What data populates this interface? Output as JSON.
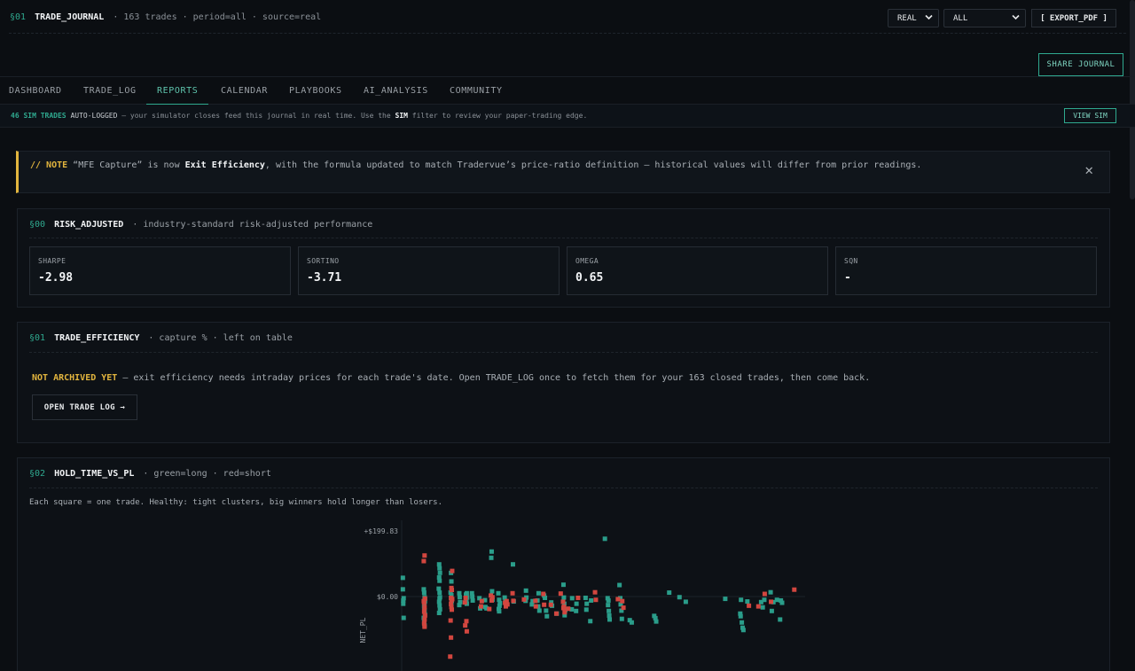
{
  "header": {
    "section": "§01",
    "title": "TRADE_JOURNAL",
    "meta": "· 163 trades · period=all · source=real",
    "source_select": "REAL",
    "period_select": "ALL",
    "export_label": "[ EXPORT_PDF ]",
    "share_label": "SHARE JOURNAL"
  },
  "tabs": [
    {
      "label": "DASHBOARD",
      "active": false
    },
    {
      "label": "TRADE_LOG",
      "active": false
    },
    {
      "label": "REPORTS",
      "active": true
    },
    {
      "label": "CALENDAR",
      "active": false
    },
    {
      "label": "PLAYBOOKS",
      "active": false
    },
    {
      "label": "AI_ANALYSIS",
      "active": false
    },
    {
      "label": "COMMUNITY",
      "active": false
    }
  ],
  "sim_banner": {
    "count": "46 SIM TRADES",
    "autolog": "AUTO-LOGGED",
    "text1": " — your simulator closes feed this journal in real time. Use the ",
    "filter": "SIM",
    "text2": " filter to review your paper-trading edge.",
    "button": "VIEW SIM"
  },
  "note": {
    "prefix": "// NOTE",
    "text1": " “MFE Capture” is now ",
    "bold": "Exit Efficiency",
    "text2": ", with the formula updated to match Tradervue’s price-ratio definition — historical values will differ from prior readings.",
    "close": "✕"
  },
  "risk": {
    "section": "§00",
    "title": "RISK_ADJUSTED",
    "subtitle": "· industry-standard risk-adjusted performance",
    "metrics": [
      {
        "label": "SHARPE",
        "value": "-2.98"
      },
      {
        "label": "SORTINO",
        "value": "-3.71"
      },
      {
        "label": "OMEGA",
        "value": "0.65"
      },
      {
        "label": "SQN",
        "value": "-"
      }
    ]
  },
  "efficiency": {
    "section": "§01",
    "title": "TRADE_EFFICIENCY",
    "subtitle": "· capture % · left on table",
    "warn": "NOT ARCHIVED YET",
    "text": " — exit efficiency needs intraday prices for each trade's date. Open TRADE_LOG once to fetch them for your 163 closed trades, then come back.",
    "button": "OPEN TRADE LOG →"
  },
  "hold": {
    "section": "§02",
    "title": "HOLD_TIME_VS_PL",
    "subtitle": "· green=long · red=short",
    "desc": "Each square = one trade. Healthy: tight clusters, big winners hold longer than losers."
  },
  "chart_data": {
    "type": "scatter",
    "ylabel": "NET_PL",
    "y_ticks": [
      "+$199.83",
      "$0.00"
    ],
    "y_max": 199.83,
    "series": [
      {
        "name": "long",
        "color": "#2a9d8a",
        "points": [
          [
            0.3,
            57
          ],
          [
            0.3,
            22
          ],
          [
            0.5,
            -5
          ],
          [
            0.4,
            -12
          ],
          [
            0.4,
            -22
          ],
          [
            0.5,
            -65
          ],
          [
            5.6,
            22
          ],
          [
            5.7,
            12
          ],
          [
            5.8,
            -2
          ],
          [
            5.9,
            -14
          ],
          [
            5.7,
            -28
          ],
          [
            5.8,
            -42
          ],
          [
            5.9,
            -55
          ],
          [
            5.6,
            -65
          ],
          [
            5.7,
            -78
          ],
          [
            5.8,
            -88
          ],
          [
            5.9,
            -7
          ],
          [
            5.8,
            -19
          ],
          [
            5.7,
            -33
          ],
          [
            9.5,
            98
          ],
          [
            9.6,
            86
          ],
          [
            9.7,
            72
          ],
          [
            9.5,
            58
          ],
          [
            9.6,
            48
          ],
          [
            9.4,
            24
          ],
          [
            9.6,
            12
          ],
          [
            9.7,
            -2
          ],
          [
            9.5,
            -16
          ],
          [
            9.6,
            -27
          ],
          [
            9.7,
            -39
          ],
          [
            9.5,
            -50
          ],
          [
            9.6,
            -6
          ],
          [
            12.5,
            72
          ],
          [
            12.6,
            46
          ],
          [
            12.4,
            12
          ],
          [
            12.6,
            4
          ],
          [
            12.5,
            -4
          ],
          [
            12.7,
            -13
          ],
          [
            12.6,
            -19
          ],
          [
            14.6,
            10
          ],
          [
            14.7,
            -2
          ],
          [
            14.8,
            -17
          ],
          [
            14.6,
            -26
          ],
          [
            16.3,
            6
          ],
          [
            16.5,
            10
          ],
          [
            16.6,
            -3
          ],
          [
            16.4,
            -14
          ],
          [
            16.5,
            -22
          ],
          [
            17.8,
            10
          ],
          [
            17.9,
            0
          ],
          [
            18.0,
            -12
          ],
          [
            19.7,
            -5
          ],
          [
            19.9,
            -36
          ],
          [
            21.1,
            -11
          ],
          [
            21.2,
            -32
          ],
          [
            21.5,
            -36
          ],
          [
            22.8,
            137
          ],
          [
            22.7,
            118
          ],
          [
            22.9,
            16
          ],
          [
            23.0,
            -10
          ],
          [
            24.5,
            10
          ],
          [
            24.7,
            -10
          ],
          [
            24.9,
            -20
          ],
          [
            24.8,
            -28
          ],
          [
            24.6,
            -38
          ],
          [
            24.7,
            -45
          ],
          [
            26.1,
            -3
          ],
          [
            26.3,
            -14
          ],
          [
            28.2,
            98
          ],
          [
            28.4,
            -15
          ],
          [
            31.5,
            18
          ],
          [
            31.6,
            -3
          ],
          [
            31.4,
            -13
          ],
          [
            33.0,
            -24
          ],
          [
            33.2,
            -14
          ],
          [
            34.4,
            -12
          ],
          [
            34.7,
            10
          ],
          [
            34.6,
            -30
          ],
          [
            34.9,
            -43
          ],
          [
            36.1,
            3
          ],
          [
            36.3,
            -4
          ],
          [
            36.6,
            -43
          ],
          [
            36.8,
            -60
          ],
          [
            37.9,
            -18
          ],
          [
            38.1,
            -28
          ],
          [
            39.3,
            -52
          ],
          [
            41.0,
            36
          ],
          [
            41.1,
            -3
          ],
          [
            41.2,
            -22
          ],
          [
            41.3,
            -57
          ],
          [
            41.4,
            -43
          ],
          [
            41.5,
            -39
          ],
          [
            43.1,
            -39
          ],
          [
            43.2,
            -5
          ],
          [
            44.3,
            -22
          ],
          [
            44.2,
            -44
          ],
          [
            46.6,
            -4
          ],
          [
            46.9,
            -22
          ],
          [
            46.8,
            -40
          ],
          [
            47.8,
            -75
          ],
          [
            48.0,
            -12
          ],
          [
            51.5,
            176
          ],
          [
            52.2,
            -5
          ],
          [
            52.4,
            -12
          ],
          [
            52.3,
            -26
          ],
          [
            52.5,
            -44
          ],
          [
            52.6,
            -58
          ],
          [
            52.7,
            -70
          ],
          [
            55.2,
            35
          ],
          [
            55.4,
            -5
          ],
          [
            55.5,
            -24
          ],
          [
            55.7,
            -43
          ],
          [
            55.8,
            -68
          ],
          [
            57.8,
            -72
          ],
          [
            58.3,
            -79
          ],
          [
            64.0,
            -59
          ],
          [
            64.3,
            -66
          ],
          [
            64.5,
            -76
          ],
          [
            67.8,
            12
          ],
          [
            70.4,
            -2
          ],
          [
            72.0,
            -16
          ],
          [
            85.8,
            -52
          ],
          [
            85.9,
            -60
          ],
          [
            86.2,
            -79
          ],
          [
            86.4,
            -95
          ],
          [
            86.6,
            -102
          ],
          [
            82.0,
            -7
          ],
          [
            86.0,
            -10
          ],
          [
            87.6,
            -15
          ],
          [
            91.1,
            -17
          ],
          [
            91.5,
            -33
          ],
          [
            91.9,
            -10
          ],
          [
            93.5,
            13
          ],
          [
            93.8,
            -44
          ],
          [
            94.2,
            -17
          ],
          [
            95.1,
            -10
          ],
          [
            96.1,
            -12
          ],
          [
            95.9,
            -70
          ],
          [
            96.4,
            -19
          ]
        ]
      },
      {
        "name": "short",
        "color": "#d2463f",
        "points": [
          [
            5.8,
            125
          ],
          [
            5.6,
            108
          ],
          [
            5.7,
            -19
          ],
          [
            5.9,
            -6
          ],
          [
            5.8,
            -33
          ],
          [
            5.7,
            -46
          ],
          [
            5.9,
            -58
          ],
          [
            5.8,
            -70
          ],
          [
            5.7,
            -82
          ],
          [
            5.8,
            -92
          ],
          [
            5.6,
            -14
          ],
          [
            12.8,
            78
          ],
          [
            12.6,
            26
          ],
          [
            12.7,
            20
          ],
          [
            12.5,
            -4
          ],
          [
            12.6,
            -12
          ],
          [
            12.8,
            -8
          ],
          [
            12.5,
            -23
          ],
          [
            12.6,
            -32
          ],
          [
            12.7,
            -40
          ],
          [
            12.4,
            -73
          ],
          [
            12.3,
            -183
          ],
          [
            12.5,
            -125
          ],
          [
            16.0,
            -18
          ],
          [
            16.2,
            -4
          ],
          [
            16.4,
            -75
          ],
          [
            16.1,
            -88
          ],
          [
            16.5,
            -106
          ],
          [
            20.1,
            -30
          ],
          [
            20.3,
            -14
          ],
          [
            22.2,
            -38
          ],
          [
            22.6,
            3
          ],
          [
            22.8,
            -12
          ],
          [
            23.0,
            -2
          ],
          [
            26.2,
            -19
          ],
          [
            26.4,
            -30
          ],
          [
            26.6,
            -14
          ],
          [
            26.8,
            -24
          ],
          [
            28.1,
            10
          ],
          [
            28.3,
            -13
          ],
          [
            31.0,
            -9
          ],
          [
            33.9,
            -13
          ],
          [
            34.0,
            -30
          ],
          [
            35.9,
            8
          ],
          [
            36.1,
            -25
          ],
          [
            37.8,
            -25
          ],
          [
            39.2,
            -52
          ],
          [
            40.3,
            9
          ],
          [
            40.9,
            -16
          ],
          [
            41.0,
            -35
          ],
          [
            41.1,
            -31
          ],
          [
            41.3,
            -48
          ],
          [
            42.2,
            -37
          ],
          [
            44.7,
            -4
          ],
          [
            49.0,
            13
          ],
          [
            49.2,
            -10
          ],
          [
            54.8,
            -8
          ],
          [
            55.9,
            -14
          ],
          [
            56.2,
            -34
          ],
          [
            88.0,
            -28
          ],
          [
            90.4,
            -30
          ],
          [
            92.0,
            8
          ],
          [
            93.6,
            -16
          ],
          [
            99.5,
            21
          ]
        ]
      }
    ]
  }
}
